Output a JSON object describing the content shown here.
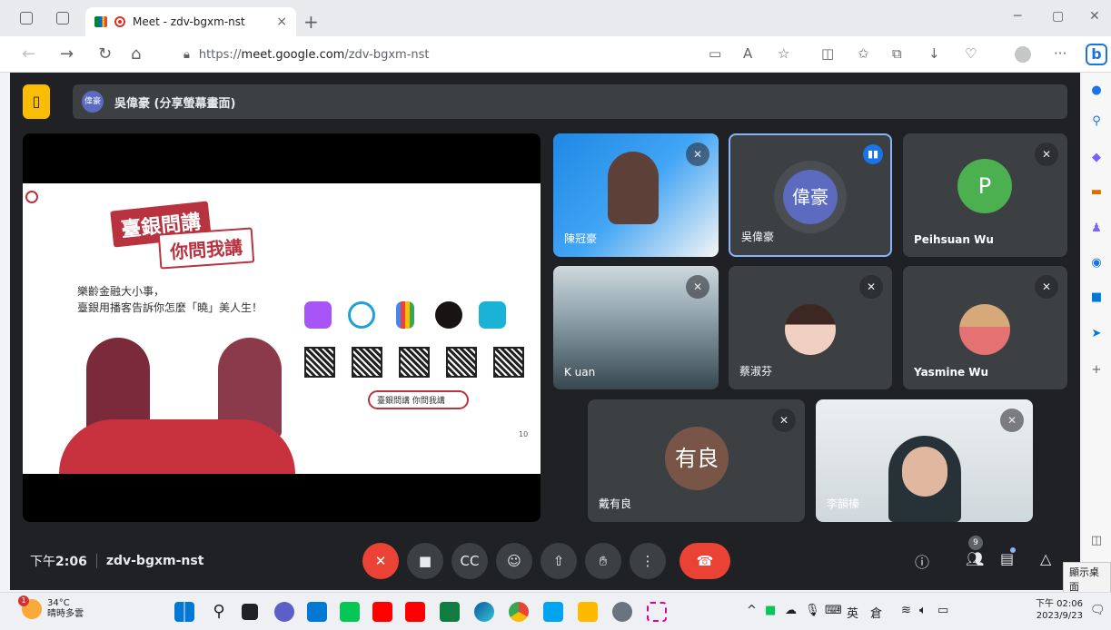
{
  "browser": {
    "tab_title": "Meet - zdv-bgxm-nst",
    "tab_close": "×",
    "new_tab": "+",
    "url_prefix": "https://",
    "url_host": "meet.google.com",
    "url_path": "/zdv-bgxm-nst",
    "more": "···",
    "bing": "b"
  },
  "meet": {
    "presenter_avatar": "偉豪",
    "presenter_text": "吳偉豪 (分享螢幕畫面)",
    "slide": {
      "title1": "臺銀問講",
      "title2": "你問我講",
      "subtitle_line1": "樂齡金融大小事，",
      "subtitle_line2": "臺銀用播客告訴你怎麼「曉」美人生！",
      "search_pill": "臺銀問講 你問我講",
      "page_number": "10"
    },
    "participants": [
      {
        "name": "陳冠豪"
      },
      {
        "name": "吳偉豪",
        "avatar": "偉豪"
      },
      {
        "name": "Peihsuan Wu",
        "avatar": "P"
      },
      {
        "name": "K uan"
      },
      {
        "name": "蔡淑芬"
      },
      {
        "name": "Yasmine Wu"
      },
      {
        "name": "戴有良",
        "avatar": "有良"
      },
      {
        "name": "李韻榛"
      }
    ],
    "time_prefix": "下午",
    "time": "2:06",
    "meeting_code": "zdv-bgxm-nst",
    "people_count": "9",
    "tooltip": "顯示桌面"
  },
  "taskbar": {
    "temp": "34°C",
    "weather": "晴時多雲",
    "alert": "1",
    "ime": "英",
    "time": "下午 02:06",
    "date": "2023/9/23"
  },
  "colors": {
    "meet_bg": "#202124",
    "tile_bg": "#3c4043",
    "red": "#ea4335",
    "accent": "#8ab4f8"
  }
}
